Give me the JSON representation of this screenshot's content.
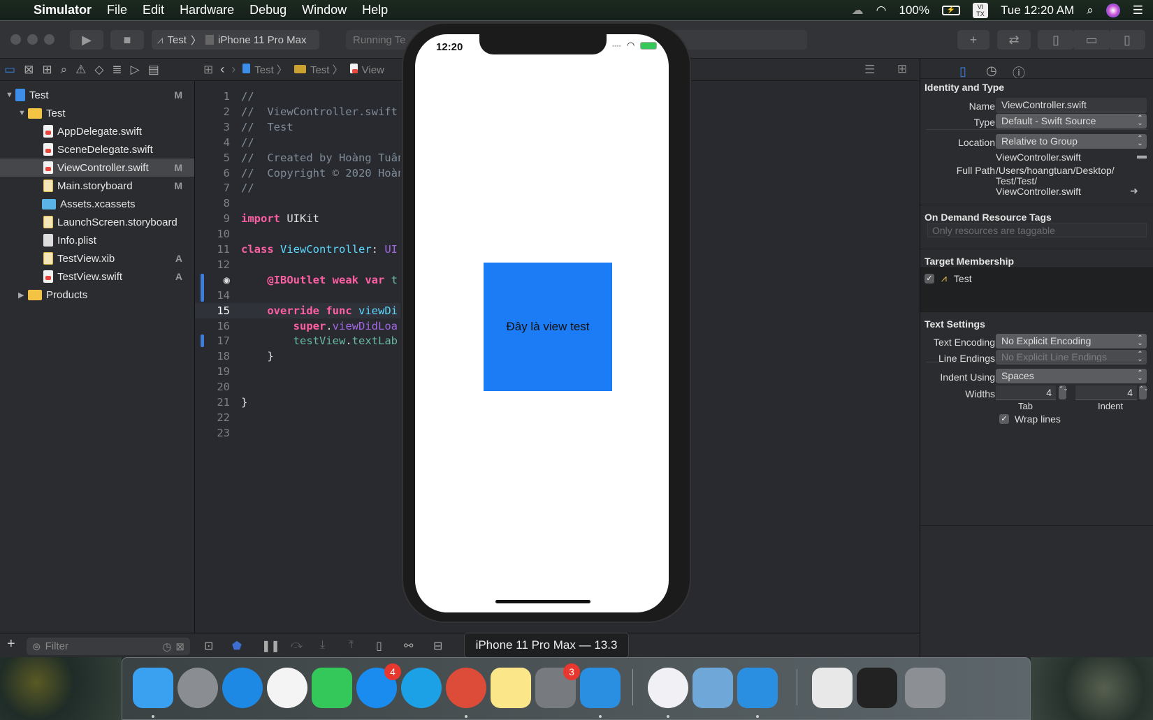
{
  "menubar": {
    "app": "Simulator",
    "items": [
      "File",
      "Edit",
      "Hardware",
      "Debug",
      "Window",
      "Help"
    ],
    "battery": "100%",
    "input_method": "VI TX",
    "clock": "Tue 12:20 AM"
  },
  "toolbar": {
    "scheme": "Test",
    "destination": "iPhone 11 Pro Max",
    "status": "Running Te"
  },
  "jumpbar": [
    "Test",
    "Test",
    "View"
  ],
  "navigator": {
    "items": [
      {
        "label": "Test",
        "badge": "M",
        "kind": "project"
      },
      {
        "label": "Test",
        "badge": "",
        "kind": "folder"
      },
      {
        "label": "AppDelegate.swift",
        "badge": "",
        "kind": "swift"
      },
      {
        "label": "SceneDelegate.swift",
        "badge": "",
        "kind": "swift"
      },
      {
        "label": "ViewController.swift",
        "badge": "M",
        "kind": "swift",
        "selected": true
      },
      {
        "label": "Main.storyboard",
        "badge": "M",
        "kind": "storyboard"
      },
      {
        "label": "Assets.xcassets",
        "badge": "",
        "kind": "assets"
      },
      {
        "label": "LaunchScreen.storyboard",
        "badge": "",
        "kind": "storyboard"
      },
      {
        "label": "Info.plist",
        "badge": "",
        "kind": "plist"
      },
      {
        "label": "TestView.xib",
        "badge": "A",
        "kind": "xib"
      },
      {
        "label": "TestView.swift",
        "badge": "A",
        "kind": "swift"
      },
      {
        "label": "Products",
        "badge": "",
        "kind": "folder"
      }
    ],
    "filter_placeholder": "Filter"
  },
  "code": {
    "current_line": 15,
    "lines": [
      [
        [
          "cmt",
          "//"
        ]
      ],
      [
        [
          "cmt",
          "//  ViewController.swift"
        ]
      ],
      [
        [
          "cmt",
          "//  Test"
        ]
      ],
      [
        [
          "cmt",
          "//"
        ]
      ],
      [
        [
          "cmt",
          "//  Created by Hoàng Tuấn"
        ]
      ],
      [
        [
          "cmt",
          "//  Copyright © 2020 Hoàng"
        ]
      ],
      [
        [
          "cmt",
          "//"
        ]
      ],
      [],
      [
        [
          "kw",
          "import"
        ],
        [
          "pl",
          " UIKit"
        ]
      ],
      [],
      [
        [
          "kw",
          "class"
        ],
        [
          "pl",
          " "
        ],
        [
          "ty",
          "ViewController"
        ],
        [
          "pl",
          ": "
        ],
        [
          "sy",
          "UI"
        ]
      ],
      [],
      [
        [
          "pl",
          "    "
        ],
        [
          "kw",
          "@IBOutlet"
        ],
        [
          "pl",
          " "
        ],
        [
          "kw",
          "weak"
        ],
        [
          "pl",
          " "
        ],
        [
          "kw",
          "var"
        ],
        [
          "pl",
          " "
        ],
        [
          "fn",
          "t"
        ]
      ],
      [],
      [
        [
          "pl",
          "    "
        ],
        [
          "kw",
          "override"
        ],
        [
          "pl",
          " "
        ],
        [
          "kw",
          "func"
        ],
        [
          "pl",
          " "
        ],
        [
          "ty",
          "viewDi"
        ]
      ],
      [
        [
          "pl",
          "        "
        ],
        [
          "kw",
          "super"
        ],
        [
          "pl",
          "."
        ],
        [
          "sy",
          "viewDidLoa"
        ]
      ],
      [
        [
          "pl",
          "        "
        ],
        [
          "fn",
          "testView"
        ],
        [
          "pl",
          "."
        ],
        [
          "fn",
          "textLab"
        ]
      ],
      [
        [
          "pl",
          "    }"
        ]
      ],
      [],
      [],
      [
        [
          "pl",
          "}"
        ]
      ],
      [],
      []
    ]
  },
  "inspector": {
    "identity": {
      "title": "Identity and Type",
      "name_label": "Name",
      "name": "ViewController.swift",
      "type_label": "Type",
      "type": "Default - Swift Source",
      "location_label": "Location",
      "location": "Relative to Group",
      "location_file": "ViewController.swift",
      "fullpath_label": "Full Path",
      "fullpath": [
        "/Users/hoangtuan/Desktop/",
        "Test/Test/",
        "ViewController.swift"
      ]
    },
    "odr": {
      "title": "On Demand Resource Tags",
      "placeholder": "Only resources are taggable"
    },
    "target": {
      "title": "Target Membership",
      "items": [
        {
          "label": "Test",
          "checked": true
        }
      ]
    },
    "text": {
      "title": "Text Settings",
      "encoding_label": "Text Encoding",
      "encoding": "No Explicit Encoding",
      "endings_label": "Line Endings",
      "endings": "No Explicit Line Endings",
      "indent_label": "Indent Using",
      "indent": "Spaces",
      "widths_label": "Widths",
      "tab": "4",
      "indent_width": "4",
      "tab_label": "Tab",
      "indent_width_label": "Indent",
      "wrap_label": "Wrap lines",
      "wrap": true
    }
  },
  "simulator": {
    "time": "12:20",
    "view_text": "Đây là view test",
    "view_color": "#1b7cf5",
    "tooltip": "iPhone 11 Pro Max — 13.3"
  },
  "dock": {
    "apps": [
      {
        "name": "finder",
        "color": "#3aa0f0",
        "running": true
      },
      {
        "name": "launchpad",
        "color": "#8a8d91"
      },
      {
        "name": "safari",
        "color": "#1e88e5"
      },
      {
        "name": "photos",
        "color": "#f4f4f4"
      },
      {
        "name": "facetime",
        "color": "#34c759"
      },
      {
        "name": "app-store",
        "color": "#1a8cf0",
        "badge": "4"
      },
      {
        "name": "skype",
        "color": "#1da1e6"
      },
      {
        "name": "chrome",
        "color": "#dd4b39",
        "running": true
      },
      {
        "name": "notes",
        "color": "#fbe68a"
      },
      {
        "name": "system-preferences",
        "color": "#777a7e",
        "badge": "3"
      },
      {
        "name": "xcode",
        "color": "#2a8fe0",
        "running": true
      },
      {
        "name": "itunes",
        "color": "#f0f0f5",
        "running": true
      },
      {
        "name": "preview",
        "color": "#6fa8d8"
      },
      {
        "name": "simulator",
        "color": "#2a8fe0",
        "running": true
      },
      {
        "name": "documents-stack",
        "color": "#e8e8e8"
      },
      {
        "name": "screenshot-stack",
        "color": "#222"
      },
      {
        "name": "trash",
        "color": "#8c9094"
      }
    ]
  }
}
